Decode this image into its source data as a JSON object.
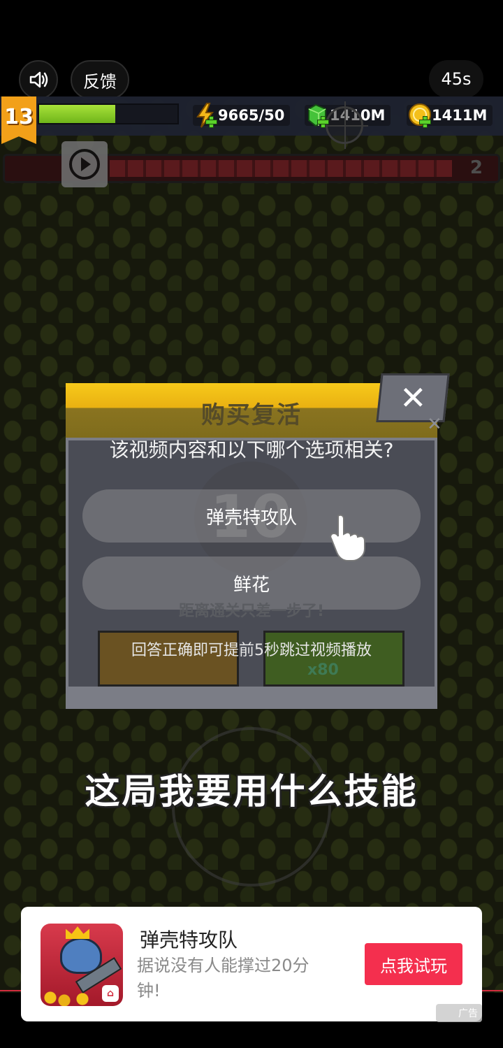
{
  "top": {
    "feedback_label": "反馈",
    "timer": "45s"
  },
  "hud": {
    "level": "13",
    "xp_progress": 0.55,
    "energy": "9665/50",
    "gems": "1410M",
    "coins": "1411M",
    "wave": "2"
  },
  "dialog": {
    "title": "购买复活",
    "question": "该视频内容和以下哪个选项相关?",
    "countdown": "10",
    "options": [
      "弹壳特攻队",
      "鲜花"
    ],
    "hint": "距离通关只差一步了!",
    "skip_note": "回答正确即可提前5秒跳过视频播放",
    "gem_cost": "x80"
  },
  "caption": "这局我要用什么技能",
  "ad": {
    "title": "弹壳特攻队",
    "description": "据说没有人能撑过20分钟!",
    "cta": "点我试玩",
    "label": "广告"
  },
  "colors": {
    "cta": "#f42f4e",
    "level_badge": "#f2a019",
    "xp_fill": "#8fd02a"
  }
}
